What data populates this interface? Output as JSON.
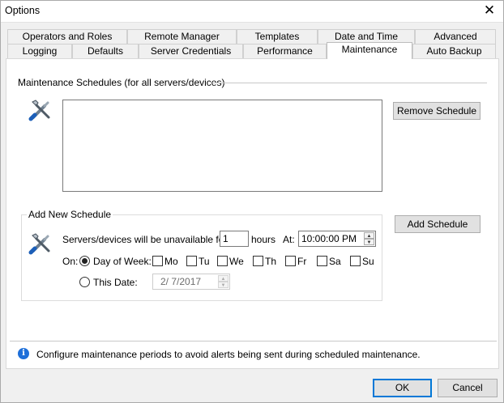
{
  "window": {
    "title": "Options",
    "close_glyph": "✕"
  },
  "tabs_row1": [
    "Operators and Roles",
    "Remote Manager",
    "Templates",
    "Date and Time",
    "Advanced"
  ],
  "tabs_row2": [
    "Logging",
    "Defaults",
    "Server Credentials",
    "Performance",
    "Maintenance",
    "Auto Backup"
  ],
  "active_tab": "Maintenance",
  "schedules": {
    "heading": "Maintenance Schedules (for all servers/devices)",
    "items": [],
    "remove_label": "Remove Schedule",
    "icon": "tools-icon"
  },
  "new_schedule": {
    "heading": "Add New Schedule",
    "add_label": "Add Schedule",
    "unavailable_label": "Servers/devices will be unavailable for:",
    "hours_value": "1",
    "hours_label": "hours",
    "at_label": "At:",
    "time_value": "10:00:00 PM",
    "on_label": "On:",
    "day_of_week_label": "Day of Week:",
    "day_of_week_selected": true,
    "days": [
      "Mo",
      "Tu",
      "We",
      "Th",
      "Fr",
      "Sa",
      "Su"
    ],
    "this_date_label": "This Date:",
    "date_value": "2/  7/2017"
  },
  "info": {
    "text": "Configure maintenance periods to avoid alerts being sent during scheduled maintenance.",
    "icon": "info-icon"
  },
  "footer": {
    "ok_label": "OK",
    "cancel_label": "Cancel"
  },
  "colors": {
    "accent": "#0078d7",
    "info": "#1e6fd9"
  }
}
